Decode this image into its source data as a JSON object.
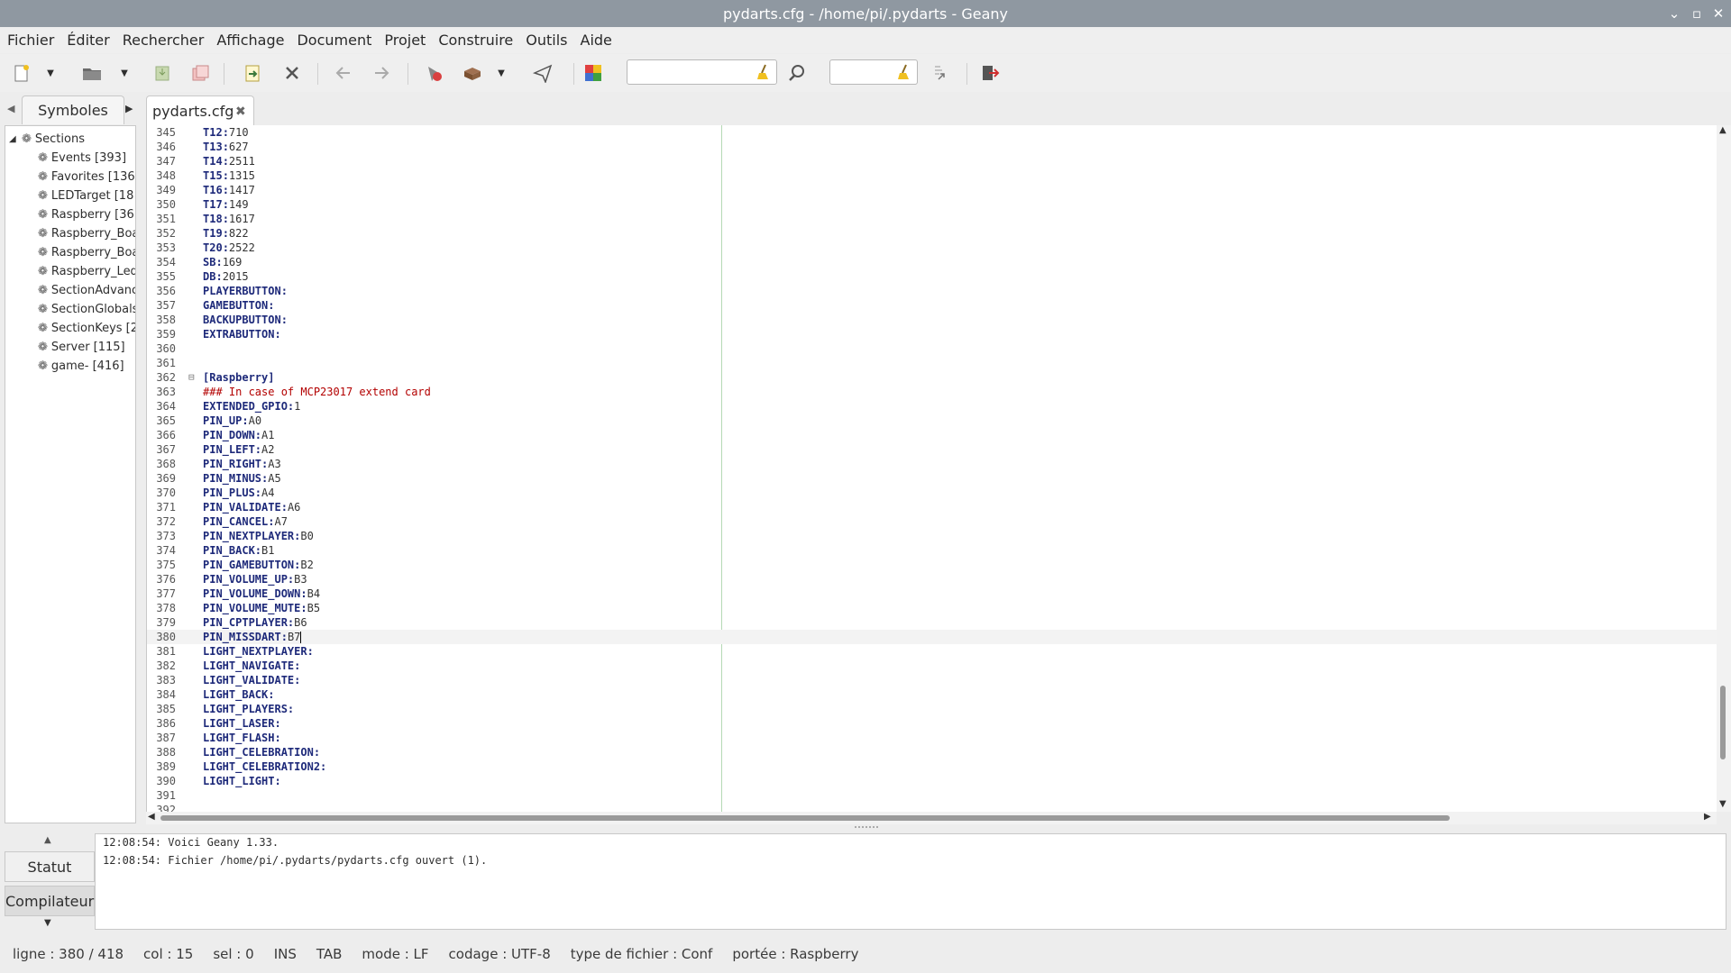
{
  "window": {
    "title": "pydarts.cfg - /home/pi/.pydarts - Geany"
  },
  "menu": [
    "Fichier",
    "Éditer",
    "Rechercher",
    "Affichage",
    "Document",
    "Projet",
    "Construire",
    "Outils",
    "Aide"
  ],
  "sidebar": {
    "tab_label": "Symboles",
    "root_label": "Sections",
    "items": [
      "Events [393]",
      "Favorites [136",
      "LEDTarget [18",
      "Raspberry [36",
      "Raspberry_Boa",
      "Raspberry_Boa",
      "Raspberry_Led",
      "SectionAdvanc",
      "SectionGlobals",
      "SectionKeys [2",
      "Server [115]",
      "game- [416]"
    ]
  },
  "editor": {
    "tab_label": "pydarts.cfg",
    "lines": [
      {
        "n": "345",
        "key": "T12",
        "sep": ":",
        "val": "710"
      },
      {
        "n": "346",
        "key": "T13",
        "sep": ":",
        "val": "627"
      },
      {
        "n": "347",
        "key": "T14",
        "sep": ":",
        "val": "2511"
      },
      {
        "n": "348",
        "key": "T15",
        "sep": ":",
        "val": "1315"
      },
      {
        "n": "349",
        "key": "T16",
        "sep": ":",
        "val": "1417"
      },
      {
        "n": "350",
        "key": "T17",
        "sep": ":",
        "val": "149"
      },
      {
        "n": "351",
        "key": "T18",
        "sep": ":",
        "val": "1617"
      },
      {
        "n": "352",
        "key": "T19",
        "sep": ":",
        "val": "822"
      },
      {
        "n": "353",
        "key": "T20",
        "sep": ":",
        "val": "2522"
      },
      {
        "n": "354",
        "key": "SB",
        "sep": ":",
        "val": "169"
      },
      {
        "n": "355",
        "key": "DB",
        "sep": ":",
        "val": "2015"
      },
      {
        "n": "356",
        "key": "PLAYERBUTTON",
        "sep": ":",
        "val": ""
      },
      {
        "n": "357",
        "key": "GAMEBUTTON",
        "sep": ":",
        "val": ""
      },
      {
        "n": "358",
        "key": "BACKUPBUTTON",
        "sep": ":",
        "val": ""
      },
      {
        "n": "359",
        "key": "EXTRABUTTON",
        "sep": ":",
        "val": ""
      },
      {
        "n": "360",
        "key": "",
        "sep": "",
        "val": ""
      },
      {
        "n": "361",
        "key": "",
        "sep": "",
        "val": ""
      },
      {
        "n": "362",
        "section": "[Raspberry]"
      },
      {
        "n": "363",
        "comment": "### In case of MCP23017 extend card"
      },
      {
        "n": "364",
        "key": "EXTENDED_GPIO",
        "sep": ":",
        "val": "1"
      },
      {
        "n": "365",
        "key": "PIN_UP",
        "sep": ":",
        "val": "A0"
      },
      {
        "n": "366",
        "key": "PIN_DOWN",
        "sep": ":",
        "val": "A1"
      },
      {
        "n": "367",
        "key": "PIN_LEFT",
        "sep": ":",
        "val": "A2"
      },
      {
        "n": "368",
        "key": "PIN_RIGHT",
        "sep": ":",
        "val": "A3"
      },
      {
        "n": "369",
        "key": "PIN_MINUS",
        "sep": ":",
        "val": "A5"
      },
      {
        "n": "370",
        "key": "PIN_PLUS",
        "sep": ":",
        "val": "A4"
      },
      {
        "n": "371",
        "key": "PIN_VALIDATE",
        "sep": ":",
        "val": "A6"
      },
      {
        "n": "372",
        "key": "PIN_CANCEL",
        "sep": ":",
        "val": "A7"
      },
      {
        "n": "373",
        "key": "PIN_NEXTPLAYER",
        "sep": ":",
        "val": "B0"
      },
      {
        "n": "374",
        "key": "PIN_BACK",
        "sep": ":",
        "val": "B1"
      },
      {
        "n": "375",
        "key": "PIN_GAMEBUTTON",
        "sep": ":",
        "val": "B2"
      },
      {
        "n": "376",
        "key": "PIN_VOLUME_UP",
        "sep": ":",
        "val": "B3"
      },
      {
        "n": "377",
        "key": "PIN_VOLUME_DOWN",
        "sep": ":",
        "val": "B4"
      },
      {
        "n": "378",
        "key": "PIN_VOLUME_MUTE",
        "sep": ":",
        "val": "B5"
      },
      {
        "n": "379",
        "key": "PIN_CPTPLAYER",
        "sep": ":",
        "val": "B6"
      },
      {
        "n": "380",
        "key": "PIN_MISSDART",
        "sep": ":",
        "val": "B7",
        "current": true
      },
      {
        "n": "381",
        "key": "LIGHT_NEXTPLAYER",
        "sep": ":",
        "val": ""
      },
      {
        "n": "382",
        "key": "LIGHT_NAVIGATE",
        "sep": ":",
        "val": ""
      },
      {
        "n": "383",
        "key": "LIGHT_VALIDATE",
        "sep": ":",
        "val": ""
      },
      {
        "n": "384",
        "key": "LIGHT_BACK",
        "sep": ":",
        "val": ""
      },
      {
        "n": "385",
        "key": "LIGHT_PLAYERS",
        "sep": ":",
        "val": ""
      },
      {
        "n": "386",
        "key": "LIGHT_LASER",
        "sep": ":",
        "val": ""
      },
      {
        "n": "387",
        "key": "LIGHT_FLASH",
        "sep": ":",
        "val": ""
      },
      {
        "n": "388",
        "key": "LIGHT_CELEBRATION",
        "sep": ":",
        "val": ""
      },
      {
        "n": "389",
        "key": "LIGHT_CELEBRATION2",
        "sep": ":",
        "val": ""
      },
      {
        "n": "390",
        "key": "LIGHT_LIGHT",
        "sep": ":",
        "val": ""
      },
      {
        "n": "391",
        "key": "",
        "sep": "",
        "val": ""
      },
      {
        "n": "392",
        "key": "",
        "sep": "",
        "val": ""
      }
    ]
  },
  "messages": {
    "tabs": [
      "Statut",
      "Compilateur"
    ],
    "lines": [
      "12:08:54: Voici Geany 1.33.",
      "12:08:54: Fichier /home/pi/.pydarts/pydarts.cfg ouvert (1)."
    ]
  },
  "status": {
    "line": "ligne : 380 / 418",
    "col": "col : 15",
    "sel": "sel : 0",
    "ins": "INS",
    "tab": "TAB",
    "mode": "mode : LF",
    "encoding": "codage : UTF-8",
    "filetype": "type de fichier : Conf",
    "scope": "portée : Raspberry"
  },
  "colors": {
    "titlebar": "#8f98a1",
    "keyword": "#1e2a7a",
    "comment": "#b30000",
    "edge_line": "#b5d9b5"
  }
}
